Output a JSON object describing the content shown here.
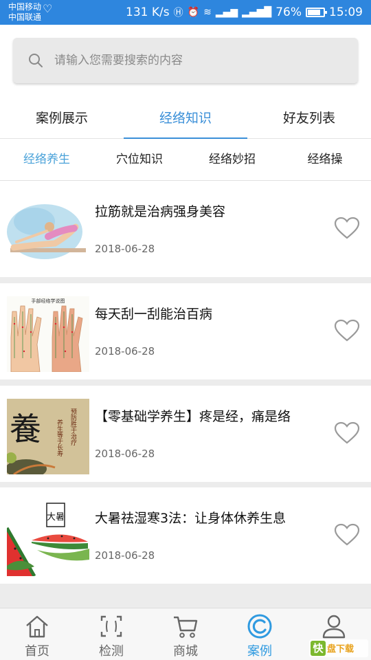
{
  "status_bar": {
    "carrier_1": "中国移动",
    "carrier_2": "中国联通",
    "speed": "131 K/s",
    "battery": "76%",
    "time": "15:09"
  },
  "search": {
    "placeholder": "请输入您需要搜索的内容",
    "value": ""
  },
  "main_tabs": [
    {
      "label": "案例展示",
      "active": false
    },
    {
      "label": "经络知识",
      "active": true
    },
    {
      "label": "好友列表",
      "active": false
    }
  ],
  "sub_tabs": [
    {
      "label": "经络养生",
      "active": true
    },
    {
      "label": "穴位知识",
      "active": false
    },
    {
      "label": "经络妙招",
      "active": false
    },
    {
      "label": "经络操",
      "active": false
    }
  ],
  "articles": [
    {
      "title": "拉筋就是治病强身美容",
      "date": "2018-06-28",
      "thumb": "stretching-illustration"
    },
    {
      "title": "每天刮一刮能治百病",
      "date": "2018-06-28",
      "thumb": "hand-acupoint-chart"
    },
    {
      "title": "【零基础学养生】疼是经，痛是络",
      "date": "2018-06-28",
      "thumb": "calligraphy-painting"
    },
    {
      "title": "大暑祛湿寒3法：让身体休养生息",
      "date": "2018-06-28",
      "thumb": "watermelon-painting"
    }
  ],
  "thumb_text": {
    "chart_heading": "手部经络学说图",
    "calligraphy_big": "養",
    "calligraphy_lines": [
      "预防胜于治疗",
      "养生等于长寿"
    ],
    "watermelon_mark": "大暑"
  },
  "bottom_nav": [
    {
      "label": "首页",
      "icon": "home-icon",
      "active": false
    },
    {
      "label": "检测",
      "icon": "scan-icon",
      "active": false
    },
    {
      "label": "商城",
      "icon": "cart-icon",
      "active": false
    },
    {
      "label": "案例",
      "icon": "case-icon",
      "active": true
    },
    {
      "label": "",
      "icon": "profile-icon",
      "active": false
    }
  ],
  "watermark": {
    "logo": "快",
    "text": "盘下载"
  },
  "colors": {
    "status_bar": "#2e86de",
    "accent": "#3a8fd8",
    "sub_accent": "#4aa2d9",
    "nav_active": "#2f9ae0"
  }
}
